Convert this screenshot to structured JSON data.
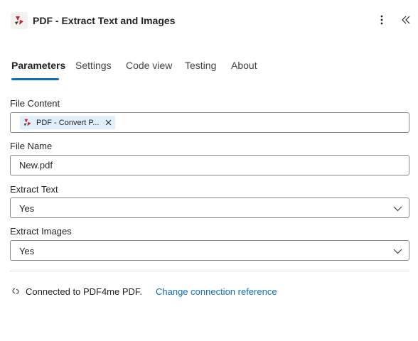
{
  "header": {
    "title": "PDF - Extract Text and Images",
    "logo_icon": "pdf4me-logo-icon",
    "more_icon": "more-vertical-icon",
    "collapse_icon": "double-chevron-left-icon"
  },
  "tabs": [
    {
      "label": "Parameters",
      "active": true
    },
    {
      "label": "Settings",
      "active": false
    },
    {
      "label": "Code view",
      "active": false
    },
    {
      "label": "Testing",
      "active": false
    },
    {
      "label": "About",
      "active": false
    }
  ],
  "fields": {
    "file_content": {
      "label": "File Content",
      "token_label": "PDF - Convert P...",
      "token_icon": "pdf4me-logo-icon"
    },
    "file_name": {
      "label": "File Name",
      "value": "New.pdf"
    },
    "extract_text": {
      "label": "Extract Text",
      "value": "Yes"
    },
    "extract_images": {
      "label": "Extract Images",
      "value": "Yes"
    }
  },
  "connection": {
    "icon": "link-icon",
    "text": "Connected to PDF4me PDF.",
    "link_label": "Change connection reference"
  },
  "colors": {
    "accent": "#0f6cbd",
    "brand_red": "#c4262e",
    "token_bg": "#e1effa"
  }
}
